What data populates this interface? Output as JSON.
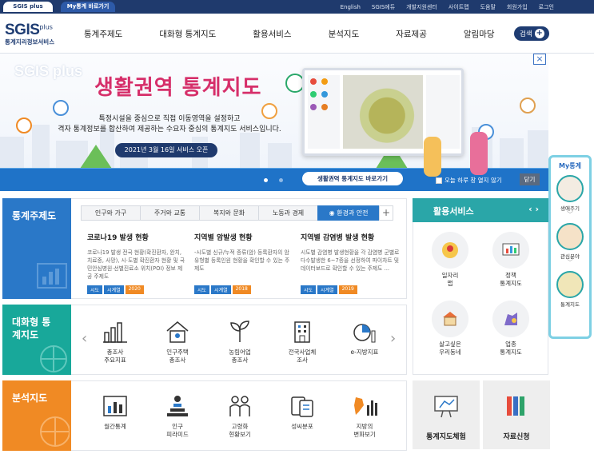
{
  "topbar": {
    "sgis_tab": "SGIS plus",
    "my_tab": "My통계 바로가기",
    "links": [
      "English",
      "SGIS에듀",
      "개발지원센터",
      "사이트맵",
      "도움말",
      "회원가입",
      "로그인"
    ]
  },
  "logo": {
    "name": "SGIS",
    "plus": "plus",
    "subtitle": "통계지리정보서비스"
  },
  "gnb": {
    "menu": [
      "통계주제도",
      "대화형 통계지도",
      "활용서비스",
      "분석지도",
      "자료제공",
      "알림마당"
    ],
    "search_label": "검색"
  },
  "banner": {
    "brand": "SGIS plus",
    "title": "생활권역 통계지도",
    "desc_line1": "특정시설을 중심으로 직접 이동영역을 설정하고",
    "desc_line2": "격자 통계정보를 합산하여 제공하는 수요자 중심의 통계지도 서비스입니다.",
    "date": "2021년 3월 16일 서비스 오픈",
    "goto_label": "생활권역 통계지도 바로가기",
    "today_label": "오늘 하루 창 열지 않기",
    "close_label": "닫기"
  },
  "thematic": {
    "label": "통계주제도",
    "tabs": [
      "인구와 가구",
      "주거와 교통",
      "복지와 문화",
      "노동과 경제",
      "환경과 안전"
    ],
    "active_tab": 4,
    "news": [
      {
        "title": "코로나19 발생 현황",
        "text": "코로나19 발생 전국 현황(확진환자, 완치, 치료중, 사망), 시·도별 확진환자 현황 및 국민안심병원·선별진료소 위치(POI) 정보 제공 주제도",
        "tags": [
          "시도",
          "시계열",
          "2020"
        ]
      },
      {
        "title": "지역별 암발생 현황",
        "text": "-시도별 신규/누적 종류(암) 등록환자의 암유형별 등록인원 현황을 확인할 수 있는 주제도",
        "tags": [
          "시도",
          "시계열",
          "2018"
        ]
      },
      {
        "title": "지역별 감염병 발생 현황",
        "text": "시도별 감염병 발생현황을 각 감염병 군별로 다수발생한 6~7종을 선정하여 파이차트 및 데이터보드로 확인할 수 있는 주제도 ...",
        "tags": [
          "시도",
          "시계열",
          "2019"
        ]
      }
    ]
  },
  "interactive": {
    "label": "대화형 통계지도",
    "items": [
      {
        "line1": "총조사",
        "line2": "주요지표",
        "icon": "bar-chart-icon"
      },
      {
        "line1": "인구주택",
        "line2": "총조사",
        "icon": "house-icon"
      },
      {
        "line1": "농림어업",
        "line2": "총조사",
        "icon": "plant-icon"
      },
      {
        "line1": "전국사업체",
        "line2": "조사",
        "icon": "building-icon"
      },
      {
        "line1": "e-지방지표",
        "line2": "",
        "icon": "pie-chart-icon"
      }
    ]
  },
  "analysis": {
    "label": "분석지도",
    "items": [
      {
        "line1": "월간통계",
        "line2": "",
        "icon": "monthly-chart-icon"
      },
      {
        "line1": "인구",
        "line2": "피라미드",
        "icon": "pyramid-icon"
      },
      {
        "line1": "고령화",
        "line2": "현황보기",
        "icon": "elderly-icon"
      },
      {
        "line1": "성씨분포",
        "line2": "",
        "icon": "surname-icon"
      },
      {
        "line1": "지방의",
        "line2": "변화보기",
        "icon": "region-map-icon"
      }
    ]
  },
  "utilization": {
    "label": "활용서비스",
    "items": [
      {
        "line1": "일자리",
        "line2": "맵",
        "icon": "job-map-icon"
      },
      {
        "line1": "정책",
        "line2": "통계지도",
        "icon": "policy-icon"
      },
      {
        "line1": "살고싶은",
        "line2": "우리동네",
        "icon": "town-icon"
      },
      {
        "line1": "업종",
        "line2": "통계지도",
        "icon": "business-icon"
      }
    ]
  },
  "bottom_cards": [
    {
      "label": "통계지도체험",
      "icon": "experience-icon"
    },
    {
      "label": "자료신청",
      "icon": "books-icon"
    }
  ],
  "my_stats": {
    "title": "My통계",
    "items": [
      "생애주기",
      "관심분야",
      "통계지도"
    ]
  },
  "colors": {
    "navy": "#1f3a6d",
    "thematic": "#2a78c8",
    "interactive": "#18a89a",
    "analysis": "#f08a24",
    "utilization": "#2aa6a8",
    "banner_title": "#d62f6a"
  }
}
